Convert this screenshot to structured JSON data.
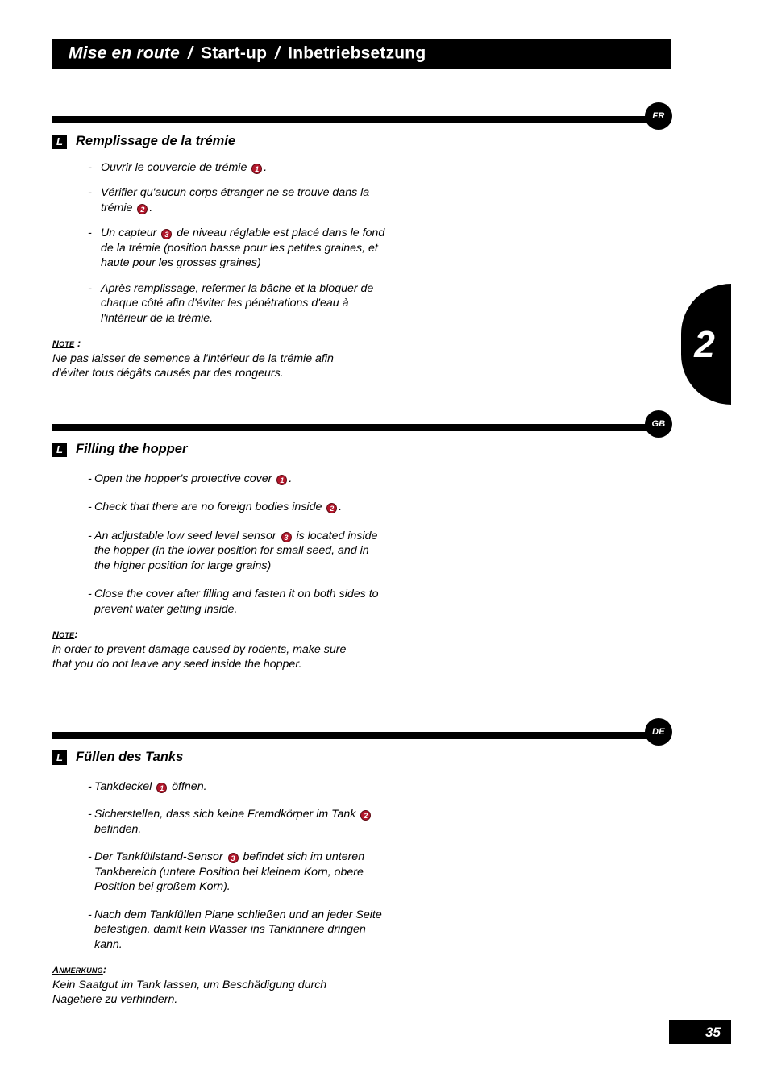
{
  "header": {
    "part1": "Mise en route",
    "sep1": "/",
    "part2": "Start-up",
    "sep2": "/",
    "part3": "Inbetriebsetzung"
  },
  "chapter_tab": {
    "number": "2"
  },
  "footer": {
    "page_number": "35"
  },
  "sections": [
    {
      "badge": "FR",
      "marker": "L",
      "title": "Remplissage de la trémie",
      "bullets": [
        {
          "dash": "-",
          "pre": "Ouvrir le couvercle de trémie ",
          "num": "1",
          "post": "."
        },
        {
          "dash": "-",
          "pre": "Vérifier qu'aucun corps étranger ne se trouve dans la trémie ",
          "num": "2",
          "post": "."
        },
        {
          "dash": "-",
          "pre": "Un capteur ",
          "num": "3",
          "post": " de niveau réglable est placé dans le fond de la trémie (position basse pour les petites graines, et haute pour les grosses graines)"
        },
        {
          "dash": "-",
          "pre": "Après remplissage, refermer la bâche et la bloquer de chaque côté afin d'éviter les pénétrations d'eau à l'intérieur de la trémie.",
          "num": "",
          "post": ""
        }
      ],
      "note_label": "Note",
      "note_suffix": " :",
      "note_text": "Ne pas laisser de semence à l'intérieur de la trémie afin d'éviter tous dégâts causés par des rongeurs."
    },
    {
      "badge": "GB",
      "marker": "L",
      "title": "Filling the hopper",
      "bullets": [
        {
          "dash": "-",
          "pre": "Open the hopper's protective cover ",
          "num": "1",
          "post": "."
        },
        {
          "dash": "-",
          "pre": "Check that there are no foreign bodies inside ",
          "num": "2",
          "post": "."
        },
        {
          "dash": "-",
          "pre": "An adjustable low seed level sensor ",
          "num": "3",
          "post": " is located inside the hopper (in the lower position for small seed, and in the higher position for large grains)"
        },
        {
          "dash": "-",
          "pre": "Close the cover after filling and fasten it on both sides to prevent water getting inside.",
          "num": "",
          "post": ""
        }
      ],
      "note_label": "Note",
      "note_suffix": ":",
      "note_text": "in order to prevent damage caused by rodents, make sure that you do not leave any seed inside the hopper."
    },
    {
      "badge": "DE",
      "marker": "L",
      "title": "Füllen des Tanks",
      "bullets": [
        {
          "dash": "-",
          "pre": "Tankdeckel ",
          "num": "1",
          "post": " öffnen."
        },
        {
          "dash": "-",
          "pre": "Sicherstellen, dass sich keine Fremdkörper im Tank ",
          "num": "2",
          "post": " befinden."
        },
        {
          "dash": "-",
          "pre": "Der Tankfüllstand-Sensor ",
          "num": "3",
          "post": " befindet sich im unteren Tankbereich (untere Position bei kleinem Korn, obere Position bei großem Korn)."
        },
        {
          "dash": "-",
          "pre": "Nach dem Tankfüllen Plane schließen und an jeder Seite befestigen, damit kein Wasser ins Tankinnere dringen kann.",
          "num": "",
          "post": ""
        }
      ],
      "note_label": "Anmerkung",
      "note_suffix": ":",
      "note_text": "Kein Saatgut im Tank lassen, um Beschädigung durch Nagetiere zu verhindern."
    }
  ]
}
